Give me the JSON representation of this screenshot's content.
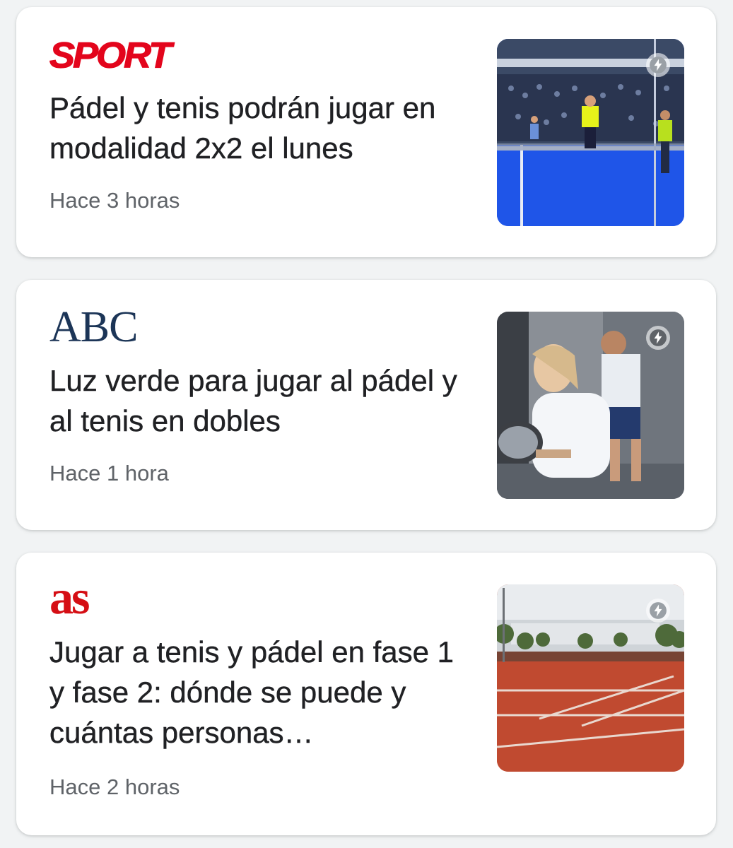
{
  "feed": {
    "articles": [
      {
        "source": "SPORT",
        "headline": "Pádel y tenis podrán jugar en modalidad 2x2 el lunes",
        "time": "Hace 3 horas",
        "thumbnail": "padel-match-blue-court-image",
        "amp_icon": "lightning-bolt-icon",
        "brand_color": "#e3051c"
      },
      {
        "source": "ABC",
        "headline": "Luz verde para jugar al pádel y al tenis en dobles",
        "time": "Hace 1 hora",
        "thumbnail": "padel-players-image",
        "amp_icon": "lightning-bolt-icon",
        "brand_color": "#1c3557"
      },
      {
        "source": "as",
        "headline": "Jugar a tenis y pádel en fase 1 y fase 2: dónde se puede y cuántas personas…",
        "time": "Hace 2 horas",
        "thumbnail": "clay-tennis-court-image",
        "amp_icon": "lightning-bolt-icon",
        "brand_color": "#d50e14"
      }
    ]
  },
  "colors": {
    "background": "#f1f3f4",
    "card": "#ffffff",
    "headline": "#202124",
    "timestamp": "#5f6368"
  }
}
